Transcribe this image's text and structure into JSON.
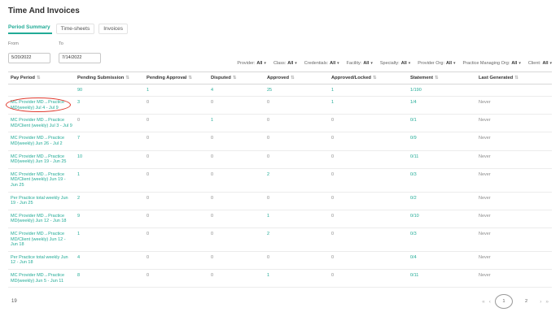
{
  "page": {
    "title": "Time And Invoices"
  },
  "tabs": [
    {
      "label": "Period Summary",
      "active": true
    },
    {
      "label": "Time-sheets",
      "active": false
    },
    {
      "label": "Invoices",
      "active": false
    }
  ],
  "date_filters": {
    "from_label": "From",
    "from_value": "5/20/2022",
    "to_label": "To",
    "to_value": "7/14/2022"
  },
  "filters": {
    "caret_icon": "▾",
    "items": [
      {
        "label": "Provider:",
        "value": "All"
      },
      {
        "label": "Class:",
        "value": "All"
      },
      {
        "label": "Credentials:",
        "value": "All"
      },
      {
        "label": "Facility:",
        "value": "All"
      },
      {
        "label": "Specialty:",
        "value": "All"
      },
      {
        "label": "Provider Org:",
        "value": "All"
      },
      {
        "label": "Practice Managing Org:",
        "value": "All"
      },
      {
        "label": "Client:",
        "value": "All"
      }
    ]
  },
  "table": {
    "sort_icon": "⇅",
    "columns": [
      "Pay Period",
      "Pending Submission",
      "Pending Approval",
      "Disputed",
      "Approved",
      "Approved/Locked",
      "Statement",
      "Last Generated"
    ],
    "totals_row": {
      "values": [
        "90",
        "1",
        "4",
        "25",
        "1",
        "1/190",
        ""
      ]
    },
    "rows": [
      {
        "pay_period": "MC Provider MD→Practice MD(weekly) Jul 4 - Jul 9",
        "values": [
          "3",
          "0",
          "0",
          "0",
          "1",
          "1/4",
          "Never"
        ],
        "annotated": true
      },
      {
        "pay_period": "MC Provider MD→Practice MD/Client (weekly) Jul 3 - Jul 9",
        "values": [
          "0",
          "0",
          "1",
          "0",
          "0",
          "0/1",
          "Never"
        ],
        "annotated": false
      },
      {
        "pay_period": "MC Provider MD→Practice MD(weekly) Jun 26 - Jul 2",
        "values": [
          "7",
          "0",
          "0",
          "0",
          "0",
          "0/9",
          "Never"
        ],
        "annotated": false
      },
      {
        "pay_period": "MC Provider MD→Practice MD(weekly) Jun 19 - Jun 25",
        "values": [
          "10",
          "0",
          "0",
          "0",
          "0",
          "0/11",
          "Never"
        ],
        "annotated": false
      },
      {
        "pay_period": "MC Provider MD→Practice MD/Client (weekly) Jun 19 - Jun 25",
        "values": [
          "1",
          "0",
          "0",
          "2",
          "0",
          "0/3",
          "Never"
        ],
        "annotated": false
      },
      {
        "pay_period": "Per Practice total weekly Jun 19 - Jun 25",
        "values": [
          "2",
          "0",
          "0",
          "0",
          "0",
          "0/2",
          "Never"
        ],
        "annotated": false
      },
      {
        "pay_period": "MC Provider MD→Practice MD(weekly) Jun 12 - Jun 18",
        "values": [
          "9",
          "0",
          "0",
          "1",
          "0",
          "0/10",
          "Never"
        ],
        "annotated": false
      },
      {
        "pay_period": "MC Provider MD→Practice MD/Client (weekly) Jun 12 - Jun 18",
        "values": [
          "1",
          "0",
          "0",
          "2",
          "0",
          "0/3",
          "Never"
        ],
        "annotated": false
      },
      {
        "pay_period": "Per Practice total weekly Jun 12 - Jun 18",
        "values": [
          "4",
          "0",
          "0",
          "0",
          "0",
          "0/4",
          "Never"
        ],
        "annotated": false
      },
      {
        "pay_period": "MC Provider MD→Practice MD(weekly) Jun 5 - Jun 11",
        "values": [
          "8",
          "0",
          "0",
          "1",
          "0",
          "0/11",
          "Never"
        ],
        "annotated": false
      }
    ]
  },
  "footer": {
    "total_count": "19",
    "pagination": {
      "first_icon": "«",
      "prev_icon": "‹",
      "pages": [
        "1",
        "2"
      ],
      "current_page": "1",
      "next_icon": "›",
      "last_icon": "»"
    }
  },
  "colors": {
    "accent_teal": "#21ab96",
    "muted_text": "#8a8a8a",
    "annotation_red": "#e03b2f"
  }
}
